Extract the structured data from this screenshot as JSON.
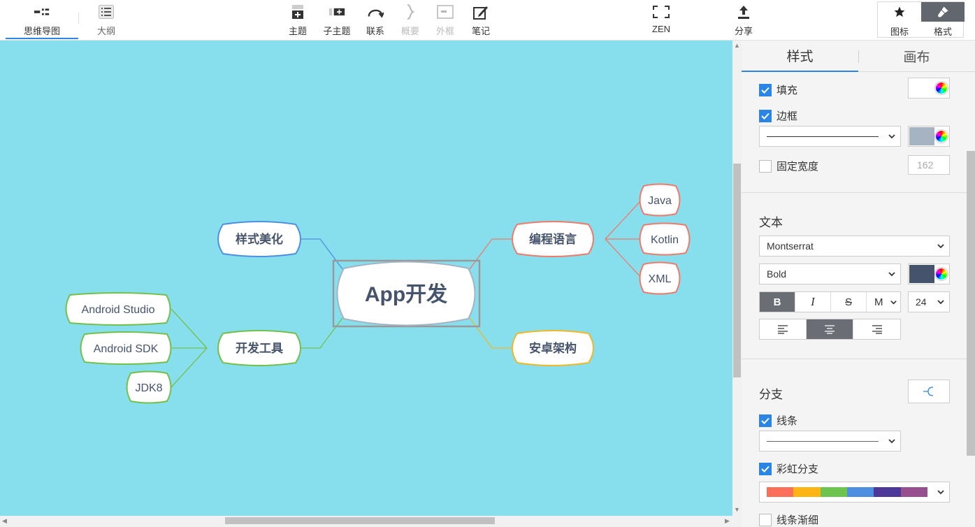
{
  "toolbar": {
    "tabs": [
      {
        "label": "思维导图",
        "icon": "mindmap-icon",
        "active": true
      },
      {
        "label": "大纲",
        "icon": "outline-list-icon",
        "active": false
      }
    ],
    "actions": [
      {
        "label": "主题",
        "icon": "topic-add-icon",
        "enabled": true
      },
      {
        "label": "子主题",
        "icon": "subtopic-add-icon",
        "enabled": true
      },
      {
        "label": "联系",
        "icon": "relation-arc-icon",
        "enabled": true
      },
      {
        "label": "概要",
        "icon": "summary-brace-icon",
        "enabled": false
      },
      {
        "label": "外框",
        "icon": "boundary-frame-icon",
        "enabled": false
      },
      {
        "label": "笔记",
        "icon": "note-pencil-icon",
        "enabled": true
      }
    ],
    "zen_label": "ZEN",
    "share_label": "分享",
    "icon_panel_label": "图标",
    "format_panel_label": "格式"
  },
  "mindmap": {
    "central": "App开发",
    "branches": [
      {
        "label": "编程语言",
        "color": "#f07a6a",
        "children": [
          "Java",
          "Kotlin",
          "XML"
        ]
      },
      {
        "label": "安卓架构",
        "color": "#f2b724",
        "children": []
      },
      {
        "label": "开发工具",
        "color": "#72c04b",
        "children": [
          "Android Studio",
          "Android SDK",
          "JDK8"
        ]
      },
      {
        "label": "样式美化",
        "color": "#4f8fe0",
        "children": []
      }
    ],
    "canvas_color": "#87dfee"
  },
  "panel": {
    "tabs": [
      "样式",
      "画布"
    ],
    "fill_label": "填充",
    "border_label": "边框",
    "border_color": "#a5b3c3",
    "fixed_width_label": "固定宽度",
    "fixed_width_value": "162",
    "text_section": "文本",
    "font_family": "Montserrat",
    "font_weight": "Bold",
    "text_color": "#46536d",
    "bold_label": "B",
    "italic_label": "I",
    "strike_label": "S",
    "more_label": "M",
    "font_size": "24",
    "branch_section": "分支",
    "line_label": "线条",
    "rainbow_label": "彩虹分支",
    "taper_label": "线条渐细",
    "rainbow_colors": [
      "#fb6f5b",
      "#fdb516",
      "#6ec44f",
      "#4f8fe0",
      "#4c3899",
      "#984f8e"
    ]
  }
}
